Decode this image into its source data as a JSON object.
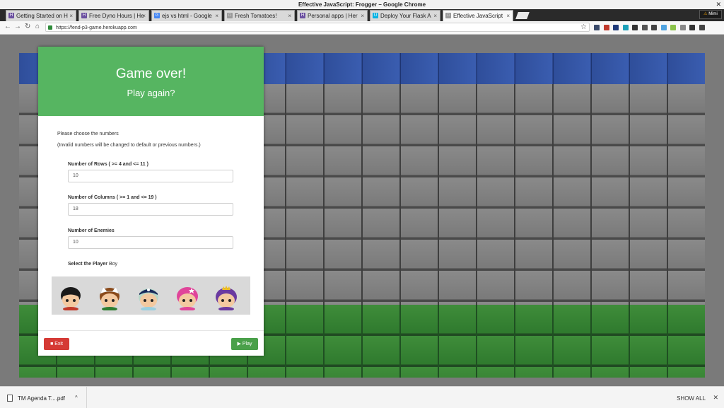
{
  "window": {
    "title": "Effective JavaScript: Frogger – Google Chrome",
    "close_glyph": "✕"
  },
  "tabs": [
    {
      "label": "Getting Started on H",
      "favicon": "H",
      "favicon_color": "#6b4fa0",
      "close": "×"
    },
    {
      "label": "Free Dyno Hours | He",
      "favicon": "H",
      "favicon_color": "#6b4fa0",
      "close": "×"
    },
    {
      "label": "ejs vs html - Google",
      "favicon": "G",
      "favicon_color": "#4285f4",
      "close": "×"
    },
    {
      "label": "Fresh Tomatoes!",
      "favicon": "□",
      "favicon_color": "#9a9a9a",
      "close": "×"
    },
    {
      "label": "Personal apps | Her",
      "favicon": "H",
      "favicon_color": "#6b4fa0",
      "close": "×"
    },
    {
      "label": "Deploy Your Flask A",
      "favicon": "U",
      "favicon_color": "#02b3e4",
      "close": "×"
    },
    {
      "label": "Effective JavaScript",
      "favicon": "□",
      "favicon_color": "#9a9a9a",
      "close": "×"
    }
  ],
  "profile": {
    "warning": "⚠",
    "name": "Mimi"
  },
  "toolbar": {
    "back": "←",
    "forward": "→",
    "reload": "↻",
    "home": "⌂",
    "star": "☆"
  },
  "address": {
    "url": "https://fend-p3-game.herokuapp.com"
  },
  "extensions": [
    "#3a4a6a",
    "#c0392b",
    "#1e3a7a",
    "#1aa0b8",
    "#333333",
    "#555555",
    "#444444",
    "#4fa3e0",
    "#8bc34a",
    "#888888",
    "#333333",
    "#444444"
  ],
  "modal": {
    "title": "Game over!",
    "subtitle": "Play again?",
    "instructions": "Please choose the numbers",
    "note": "(Invalid numbers will be changed to default or previous numbers.)",
    "rows_label": "Number of Rows ( >= 4 and <= 11 )",
    "rows_value": "10",
    "columns_label": "Number of Columns ( >= 1 and <= 19 )",
    "columns_value": "18",
    "enemies_label": "Number of Enemies",
    "enemies_value": "10",
    "player_label": "Select the Player",
    "player_value": "Boy",
    "exit_label": "Exit",
    "play_label": "Play",
    "characters": [
      {
        "name": "boy",
        "hair": "#1a1a1a",
        "accent": "#1a1a1a"
      },
      {
        "name": "cat-girl",
        "hair": "#8a4a1a",
        "accent": "#ffffff"
      },
      {
        "name": "horn-girl",
        "hair": "#b8d8c8",
        "accent": "#1a2a5a"
      },
      {
        "name": "pink-girl",
        "hair": "#e0459a",
        "accent": "#e0459a"
      },
      {
        "name": "princess-girl",
        "hair": "#6a3aa0",
        "accent": "#f0c020"
      }
    ]
  },
  "downloads": {
    "file": "TM Agenda T....pdf",
    "caret": "^",
    "show_all": "SHOW ALL",
    "close": "✕"
  }
}
